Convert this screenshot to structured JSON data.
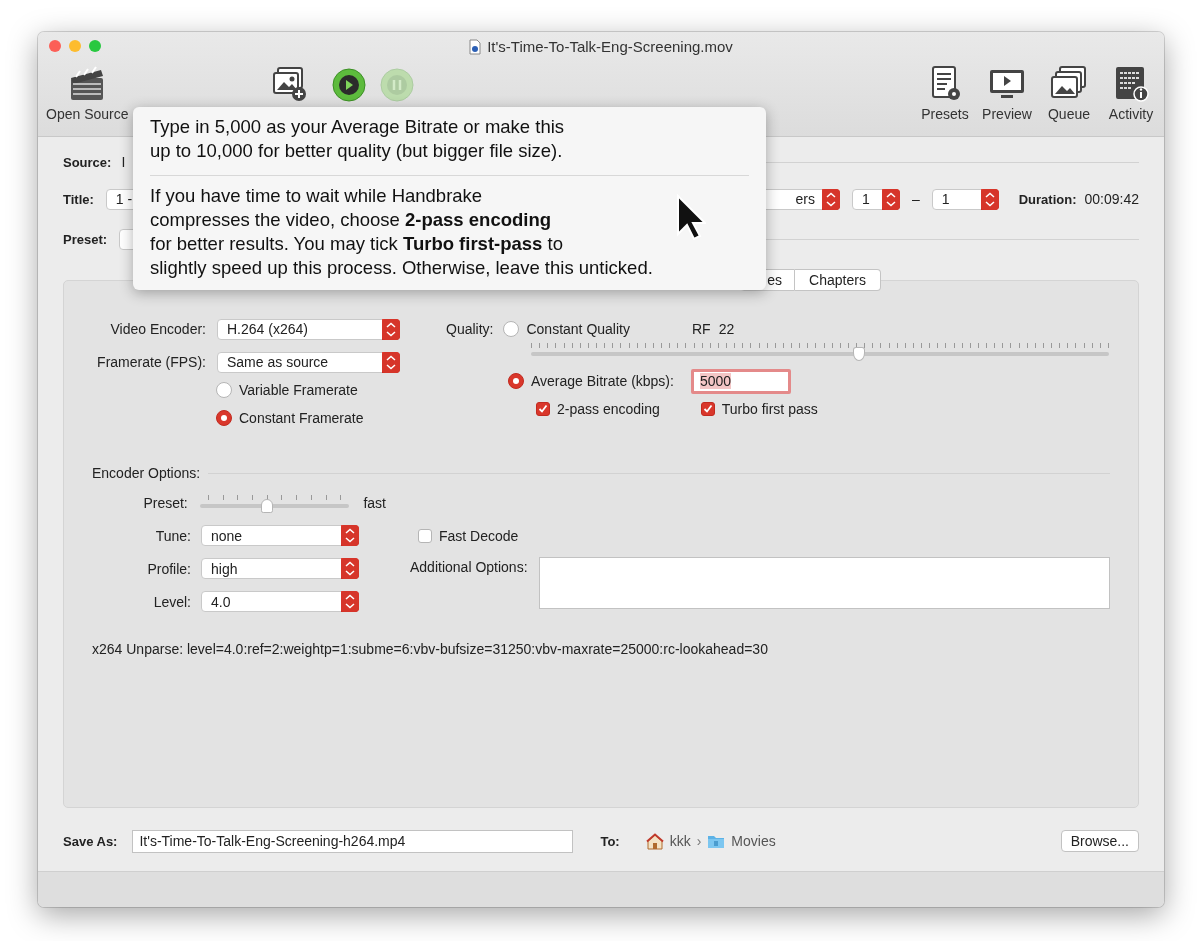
{
  "window": {
    "title": "It's-Time-To-Talk-Eng-Screening.mov"
  },
  "toolbar": {
    "left": [
      {
        "kind": "open-source",
        "label": "Open Source"
      },
      {
        "kind": "add-queue"
      },
      {
        "kind": "play",
        "disabled": false
      },
      {
        "kind": "pause",
        "disabled": true
      }
    ],
    "right": [
      {
        "kind": "presets",
        "label": "Presets"
      },
      {
        "kind": "preview",
        "label": "Preview"
      },
      {
        "kind": "queue",
        "label": "Queue"
      },
      {
        "kind": "activity",
        "label": "Activity"
      }
    ]
  },
  "source": {
    "label": "Source:",
    "value": "I"
  },
  "title_row": {
    "label": "Title:",
    "title_value": "1 -",
    "range_mode": "ers",
    "range_start": "1",
    "range_separator": "–",
    "range_end": "1",
    "duration_label": "Duration:",
    "duration": "00:09:42"
  },
  "preset": {
    "label": "Preset:"
  },
  "tabs": [
    {
      "label": "es",
      "selected": false
    },
    {
      "label": "Chapters",
      "selected": false
    }
  ],
  "video": {
    "encoder_label": "Video Encoder:",
    "encoder": "H.264 (x264)",
    "framerate_label": "Framerate (FPS):",
    "framerate": "Same as source",
    "framerate_modes": [
      {
        "label": "Variable Framerate",
        "selected": false
      },
      {
        "label": "Constant Framerate",
        "selected": true
      }
    ],
    "quality_label": "Quality:",
    "constant_quality": {
      "label": "Constant Quality",
      "selected": false,
      "rf_label": "RF",
      "rf_value": "22",
      "level": 0.567
    },
    "average_bitrate": {
      "label": "Average Bitrate (kbps):",
      "selected": true,
      "value": "5000",
      "focused": true
    },
    "options": [
      {
        "label": "2-pass encoding",
        "checked": true
      },
      {
        "label": "Turbo first pass",
        "checked": true
      }
    ]
  },
  "encoder_options": {
    "title": "Encoder Options:",
    "preset_label": "Preset:",
    "preset_slider": {
      "level": 0.45
    },
    "preset_value": "fast",
    "tune_label": "Tune:",
    "tune": "none",
    "profile_label": "Profile:",
    "profile": "high",
    "level_label": "Level:",
    "level_value": "4.0",
    "fast_decode": {
      "label": "Fast Decode",
      "checked": false
    },
    "additional_label": "Additional Options:",
    "unparse": "x264 Unparse: level=4.0:ref=2:weightp=1:subme=6:vbv-bufsize=31250:vbv-maxrate=25000:rc-lookahead=30"
  },
  "save_as": {
    "label": "Save As:",
    "value": "It's-Time-To-Talk-Eng-Screening-h264.mp4"
  },
  "destination": {
    "label": "To:",
    "path": [
      {
        "kind": "home",
        "label": "kkk"
      },
      {
        "kind": "folder",
        "label": "Movies"
      }
    ],
    "separator": "›"
  },
  "browse": "Browse...",
  "popover": {
    "paragraphs": [
      "Type in 5,000 as your Average Bitrate or make this\nup to 10,000 for better quality (but bigger file size).",
      "If you have time to wait while Handbrake\ncompresses the video, choose **2-pass encoding**\nfor better results. You may tick **Turbo first-pass** to\nslightly speed up this process. Otherwise, leave this unticked."
    ]
  }
}
